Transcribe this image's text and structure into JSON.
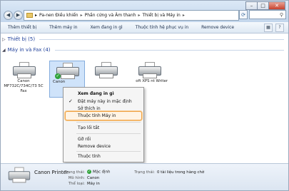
{
  "address": {
    "crumbs": [
      "Pa-nen Điều khiển",
      "Phần cứng và Âm thanh",
      "Thiết bị và Máy in"
    ],
    "separator": "▸"
  },
  "toolbar": {
    "items": [
      "Thêm thiết bị",
      "Thêm máy in",
      "Xem đang in gì",
      "Thuộc tính hệ phục vụ in",
      "Remove device"
    ]
  },
  "groups": {
    "devices": "Thiết bị (5)",
    "printers": "Máy in và Fax (4)"
  },
  "printers": [
    {
      "label": "Canon MF732C/734C/73 5C Fax"
    },
    {
      "label": "Canon"
    },
    {
      "label": ""
    },
    {
      "label": "oft XPS nt Writer"
    }
  ],
  "context_menu": {
    "items": [
      {
        "label": "Xem đang in gì",
        "bold": true
      },
      {
        "label": "Đặt máy này in mặc định",
        "checked": true
      },
      {
        "label": "Sở thích in"
      },
      {
        "label": "Thuộc tính Máy in",
        "highlighted": true
      },
      {
        "label": "Tạo lối tắt"
      },
      {
        "label": "Gỡ rối"
      },
      {
        "label": "Remove device"
      },
      {
        "label": "Thuộc tính"
      }
    ]
  },
  "details": {
    "name": "Canon Printer",
    "status_label": "Trạng thái:",
    "status_value": "Mặc định",
    "queue_label": "Trạng thái:",
    "queue_value": "0 tài liệu trong hàng chờ",
    "model_label": "Mô hình:",
    "model_value": "Canon",
    "category_label": "Thể loại:",
    "category_value": "Máy in"
  },
  "colors": {
    "accent_highlight": "#f0a54a",
    "group_header": "#1e3f9a",
    "default_check": "#2fa339"
  }
}
